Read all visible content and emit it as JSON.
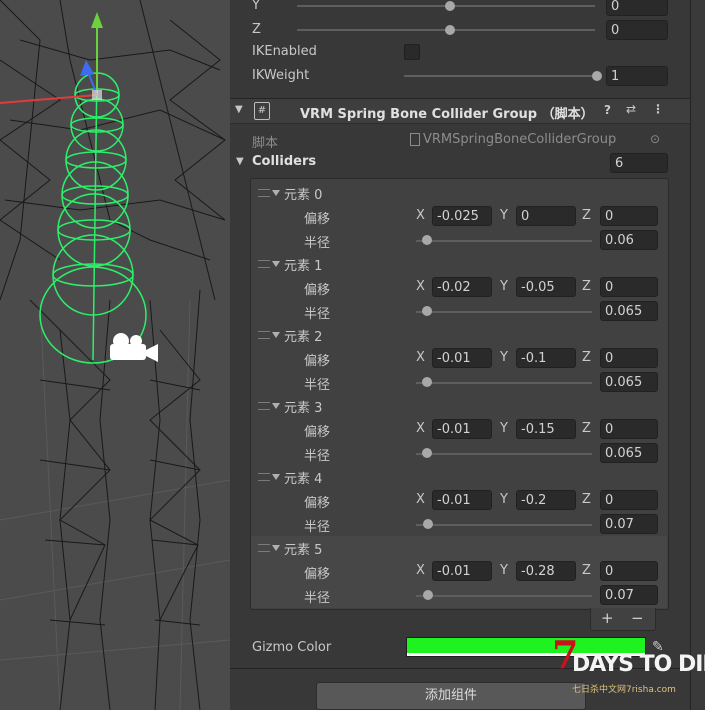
{
  "ik": {
    "y_label": "Y",
    "y_value": "0",
    "z_label": "Z",
    "z_value": "0",
    "enabled_label": "IKEnabled",
    "weight_label": "IKWeight",
    "weight_value": "1"
  },
  "component": {
    "title": "VRM Spring Bone Collider Group （脚本）",
    "script_label": "脚本",
    "script_value": "VRMSpringBoneColliderGroup",
    "colliders_label": "Colliders",
    "colliders_count": "6",
    "offset_label": "偏移",
    "radius_label": "半径",
    "axis_x": "X",
    "axis_y": "Y",
    "axis_z": "Z",
    "elements": [
      {
        "name": "元素 0",
        "x": "-0.025",
        "y": "0",
        "z": "0",
        "radius": "0.06",
        "radius_fraction": 0.06
      },
      {
        "name": "元素 1",
        "x": "-0.02",
        "y": "-0.05",
        "z": "0",
        "radius": "0.065",
        "radius_fraction": 0.065
      },
      {
        "name": "元素 2",
        "x": "-0.01",
        "y": "-0.1",
        "z": "0",
        "radius": "0.065",
        "radius_fraction": 0.065
      },
      {
        "name": "元素 3",
        "x": "-0.01",
        "y": "-0.15",
        "z": "0",
        "radius": "0.065",
        "radius_fraction": 0.065
      },
      {
        "name": "元素 4",
        "x": "-0.01",
        "y": "-0.2",
        "z": "0",
        "radius": "0.07",
        "radius_fraction": 0.07
      },
      {
        "name": "元素 5",
        "x": "-0.01",
        "y": "-0.28",
        "z": "0",
        "radius": "0.07",
        "radius_fraction": 0.07
      }
    ],
    "add_symbol": "+",
    "remove_symbol": "−",
    "gizmo_label": "Gizmo Color",
    "gizmo_color": "#1ff31f"
  },
  "add_component_button": "添加组件",
  "watermark": {
    "brand": "DAYS TO DIE",
    "seven": "7",
    "site": "七日杀中文网7risha.com"
  },
  "colors": {
    "accent_green": "#1ff31f",
    "panel": "#383838"
  }
}
